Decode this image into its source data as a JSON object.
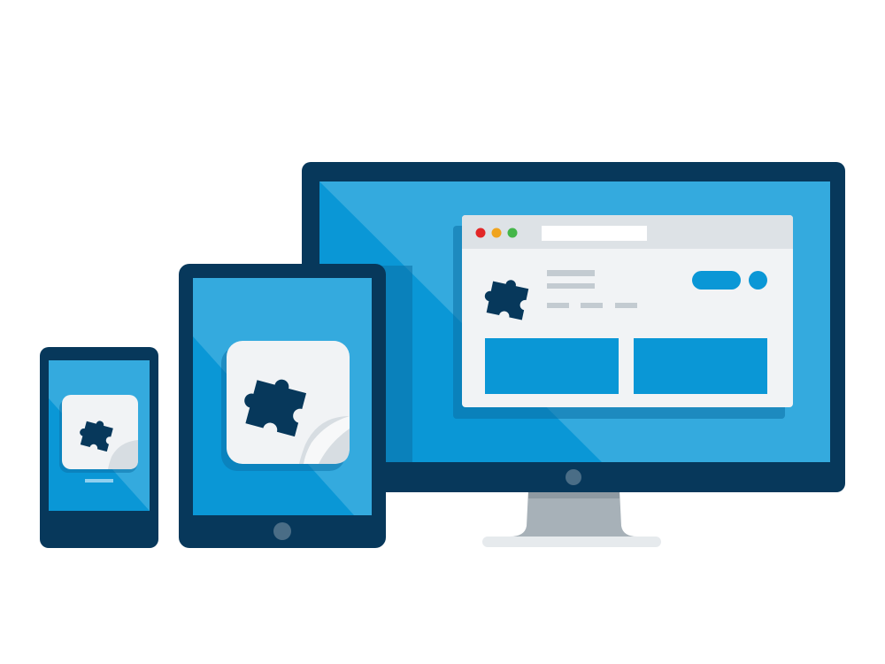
{
  "scene": {
    "description_free": true,
    "devices": [
      "smartphone",
      "tablet",
      "desktop-monitor"
    ]
  },
  "colors": {
    "frame": "#07385b",
    "screen": "#2ea7df",
    "screen_dark": "#0a97d6",
    "browser_bg": "#f1f3f5",
    "browser_bar": "#dde2e6",
    "placeholder_line": "#c3cbd1",
    "accent": "#0a97d6",
    "stand": "#a7b1b8",
    "stand_light": "#c4ccd2",
    "base": "#e6eaed",
    "dot_red": "#e22727",
    "dot_yellow": "#f0a41e",
    "dot_green": "#44b649",
    "puzzle": "#07385b",
    "tile": "#f1f3f5"
  },
  "icons": {
    "puzzle": "puzzle-piece-icon",
    "home_button": "home-button-icon"
  }
}
